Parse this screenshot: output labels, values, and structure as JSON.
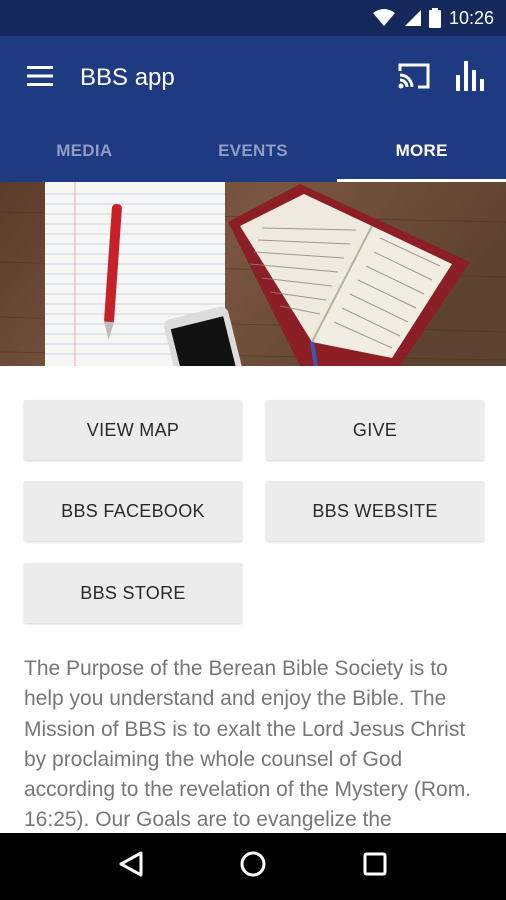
{
  "status_bar": {
    "time": "10:26",
    "icons": [
      "wifi-icon",
      "cell-signal-icon",
      "battery-icon"
    ]
  },
  "app_bar": {
    "title": "BBS app",
    "icons": [
      "menu-icon",
      "cast-icon",
      "bar-chart-icon"
    ]
  },
  "tabs": [
    {
      "label": "MEDIA",
      "active": false
    },
    {
      "label": "EVENTS",
      "active": false
    },
    {
      "label": "MORE",
      "active": true
    }
  ],
  "buttons": [
    {
      "label": "VIEW MAP"
    },
    {
      "label": "GIVE"
    },
    {
      "label": "BBS FACEBOOK"
    },
    {
      "label": "BBS WEBSITE"
    },
    {
      "label": "BBS STORE"
    }
  ],
  "description": "The Purpose of the Berean Bible Society is to help you understand and enjoy the Bible.  The Mission of BBS is to exalt the Lord Jesus Christ by proclaiming the whole counsel of God according to the revelation of the Mystery (Rom. 16:25).  Our Goals are to evangelize the",
  "nav_bar": {
    "icons": [
      "back-icon",
      "home-icon",
      "recents-icon"
    ]
  },
  "colors": {
    "primary": "#1e3a80",
    "status_bar": "#14285c",
    "tab_inactive": "#8e9cc6",
    "button_bg": "#ececec"
  }
}
